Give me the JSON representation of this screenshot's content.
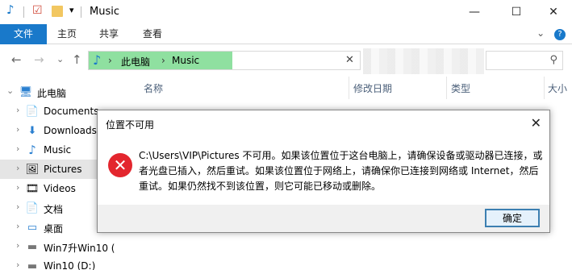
{
  "window": {
    "title": "Music",
    "controls": {
      "minimize": "—",
      "maximize": "☐",
      "close": "✕"
    }
  },
  "quick_access": {
    "music_icon": "♪",
    "properties_icon": "☑",
    "folder_icon": "▬",
    "dropdown": "▾"
  },
  "ribbon": {
    "tabs": [
      "文件",
      "主页",
      "共享",
      "查看"
    ],
    "expand_icon": "⌄",
    "help_icon": "?"
  },
  "nav": {
    "back": "←",
    "forward": "→",
    "recent": "⌄",
    "up": "↑",
    "breadcrumb_root_icon": "♪",
    "breadcrumb": [
      "此电脑",
      "Music"
    ],
    "separator": "›",
    "clear": "✕",
    "search_icon": "⚲"
  },
  "sidebar": {
    "items": [
      {
        "label": "此电脑",
        "icon": "pc-icon",
        "glyph": "🖥",
        "chevron": "⌄",
        "root": true
      },
      {
        "label": "Documents",
        "icon": "documents-icon",
        "glyph": "📄",
        "chevron": "›"
      },
      {
        "label": "Downloads",
        "icon": "download-icon",
        "glyph": "⬇",
        "chevron": "›"
      },
      {
        "label": "Music",
        "icon": "music-icon",
        "glyph": "♪",
        "chevron": "›"
      },
      {
        "label": "Pictures",
        "icon": "pictures-icon",
        "glyph": "🖼",
        "chevron": "›",
        "selected": true
      },
      {
        "label": "Videos",
        "icon": "videos-icon",
        "glyph": "🎞",
        "chevron": "›"
      },
      {
        "label": "文档",
        "icon": "document-icon",
        "glyph": "📄",
        "chevron": "›"
      },
      {
        "label": "桌面",
        "icon": "desktop-icon",
        "glyph": "▭",
        "chevron": "›"
      },
      {
        "label": "Win7升Win10 (",
        "icon": "drive-icon",
        "glyph": "▬",
        "chevron": "›"
      },
      {
        "label": "Win10 (D:)",
        "icon": "drive-icon",
        "glyph": "▬",
        "chevron": "›"
      }
    ]
  },
  "columns": [
    "名称",
    "修改日期",
    "类型",
    "大小"
  ],
  "dialog": {
    "title": "位置不可用",
    "close": "✕",
    "error_glyph": "✕",
    "message": "C:\\Users\\VIP\\Pictures 不可用。如果该位置位于这台电脑上，请确保设备或驱动器已连接，或者光盘已插入，然后重试。如果该位置位于网络上，请确保你已连接到网络或 Internet，然后重试。如果仍然找不到该位置，则它可能已移动或删除。",
    "ok_label": "确定"
  },
  "colors": {
    "accent": "#1979ca",
    "breadcrumb_highlight": "#8fe0a0",
    "error_red": "#e3262e",
    "selected": "#e5e5e5"
  }
}
